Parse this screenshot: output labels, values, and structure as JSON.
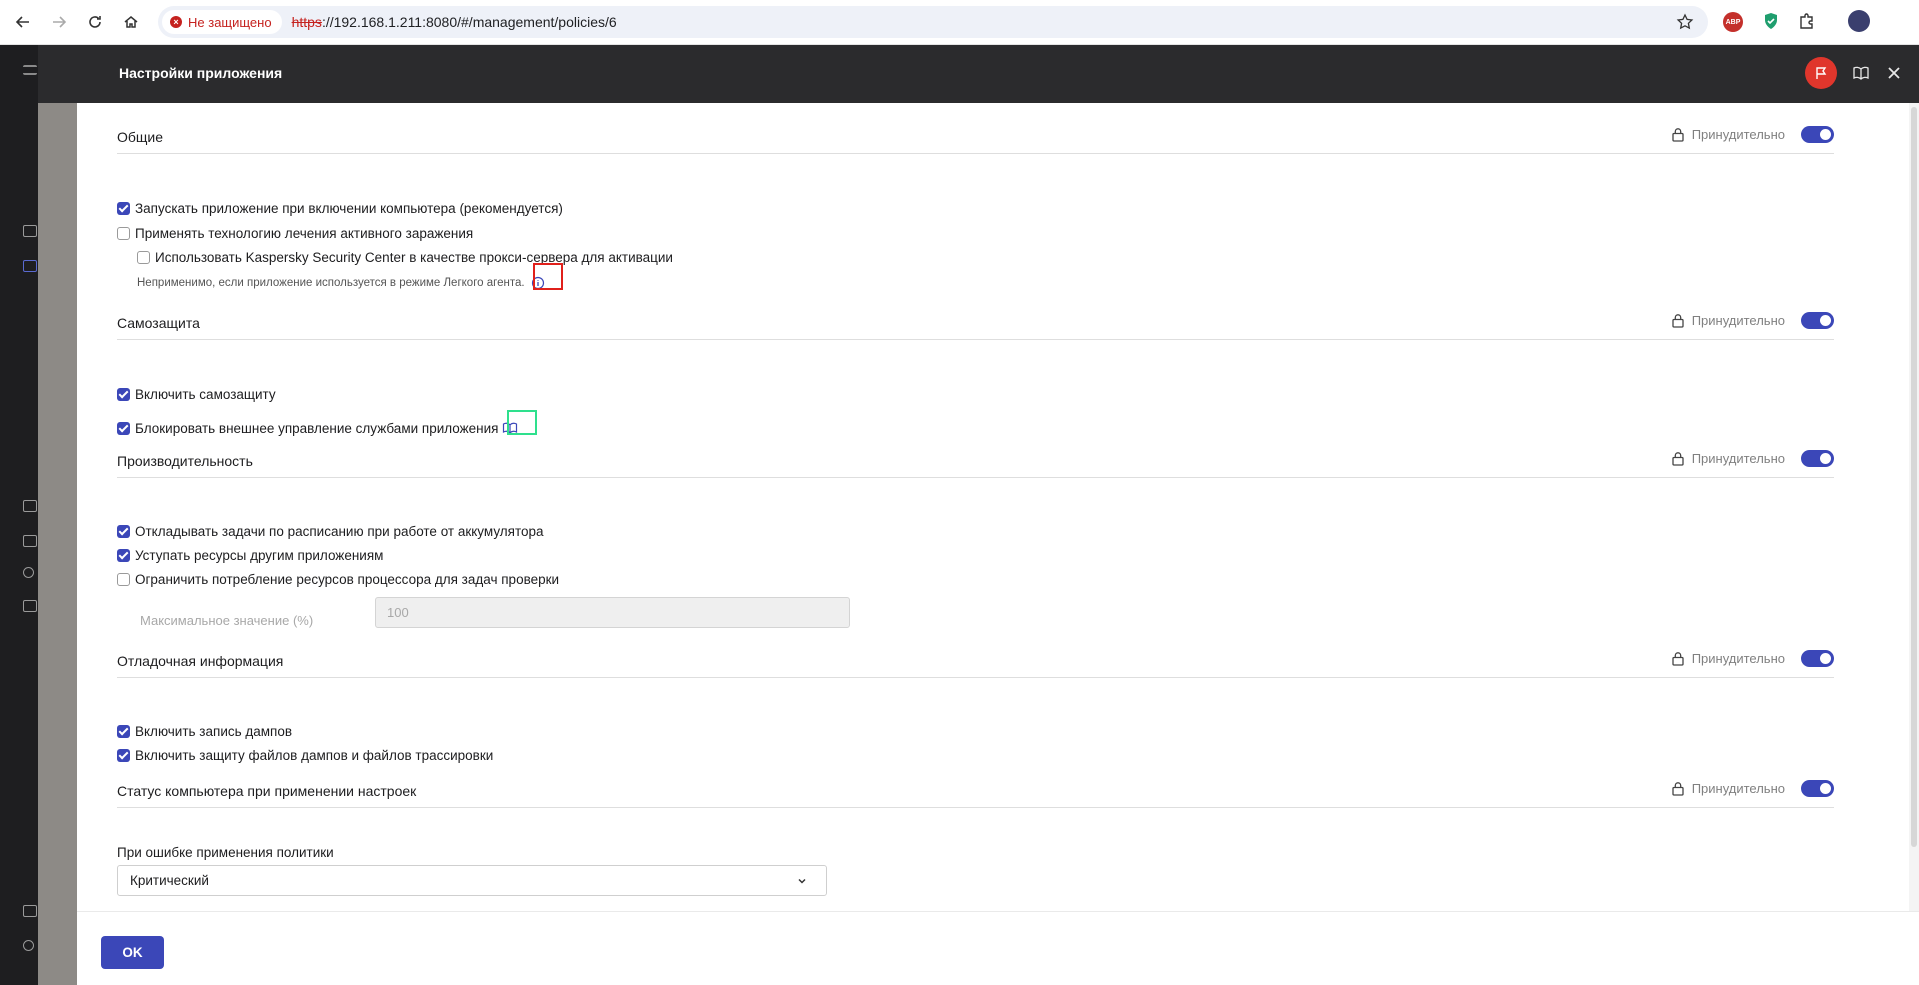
{
  "browser": {
    "security_label": "Не защищено",
    "url_scheme": "https",
    "url_rest": "://192.168.1.211:8080/#/management/policies/6",
    "abp_label": "ABP"
  },
  "modal": {
    "title": "Настройки приложения",
    "enforce_label": "Принудительно",
    "ok_label": "OK"
  },
  "sections": {
    "general": {
      "title": "Общие",
      "items": [
        {
          "label": "Запускать приложение при включении компьютера (рекомендуется)",
          "checked": true
        },
        {
          "label": "Применять технологию лечения активного заражения",
          "checked": false
        },
        {
          "label": "Использовать Kaspersky Security Center в качестве прокси-сервера для активации",
          "checked": false
        }
      ],
      "note": "Неприменимо, если приложение используется в режиме Легкого агента."
    },
    "self_defense": {
      "title": "Самозащита",
      "items": [
        {
          "label": "Включить самозащиту",
          "checked": true
        },
        {
          "label": "Блокировать внешнее управление службами приложения",
          "checked": true
        }
      ]
    },
    "performance": {
      "title": "Производительность",
      "items": [
        {
          "label": "Откладывать задачи по расписанию при работе от аккумулятора",
          "checked": true
        },
        {
          "label": "Уступать ресурсы другим приложениям",
          "checked": true
        },
        {
          "label": "Ограничить потребление ресурсов процессора для задач проверки",
          "checked": false
        }
      ],
      "max_label": "Максимальное значение (%)",
      "max_value": "100"
    },
    "debug": {
      "title": "Отладочная информация",
      "items": [
        {
          "label": "Включить запись дампов",
          "checked": true
        },
        {
          "label": "Включить защиту файлов дампов и файлов трассировки",
          "checked": true
        }
      ]
    },
    "status": {
      "title": "Статус компьютера при применении настроек",
      "select_label": "При ошибке применения политики",
      "select_value": "Критический"
    }
  },
  "colors": {
    "accent": "#3b47b8",
    "header_bg": "#2b2b2d",
    "flag_red": "#e0362c",
    "highlight_red": "#e0201b",
    "highlight_green": "#2ee08d"
  }
}
